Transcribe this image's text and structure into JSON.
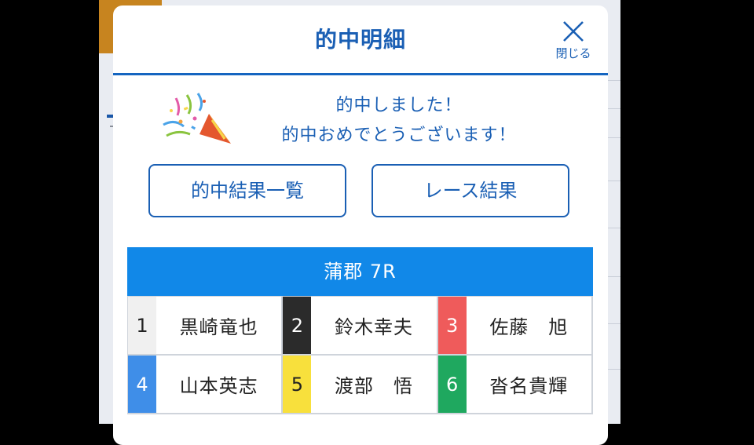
{
  "modal": {
    "title": "的中明細",
    "close_label": "閉じる"
  },
  "congrats": {
    "line1": "的中しました！",
    "line2": "的中おめでとうございます！"
  },
  "buttons": {
    "hit_results": "的中結果一覧",
    "race_results": "レース結果"
  },
  "race": {
    "title": "蒲郡 7R",
    "racers": [
      {
        "number": "1",
        "name": "黒崎竜也",
        "bg": "#f0f0f0",
        "fg": "#222222"
      },
      {
        "number": "2",
        "name": "鈴木幸夫",
        "bg": "#2b2b2b",
        "fg": "#ffffff"
      },
      {
        "number": "3",
        "name": "佐藤　旭",
        "bg": "#ef5b5b",
        "fg": "#ffffff"
      },
      {
        "number": "4",
        "name": "山本英志",
        "bg": "#3f8ee8",
        "fg": "#ffffff"
      },
      {
        "number": "5",
        "name": "渡部　悟",
        "bg": "#f8e03c",
        "fg": "#222222"
      },
      {
        "number": "6",
        "name": "沓名貴輝",
        "bg": "#1fa85f",
        "fg": "#ffffff"
      }
    ]
  },
  "colors": {
    "accent": "#1a5fb4",
    "race_header": "#1188e8"
  },
  "icons": {
    "close": "close-icon",
    "celebration": "party-popper-icon"
  }
}
